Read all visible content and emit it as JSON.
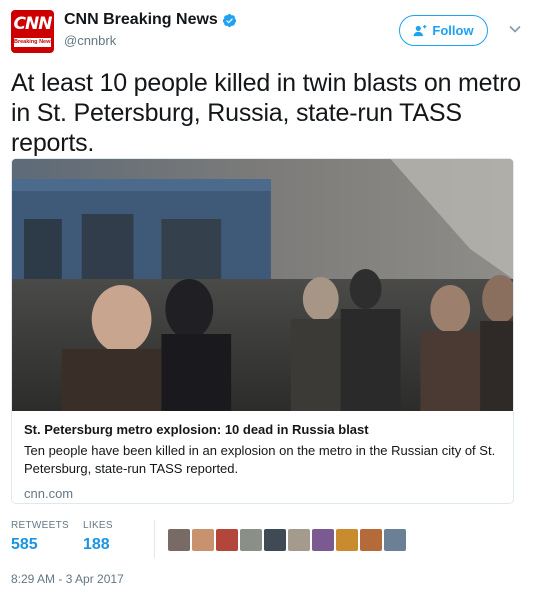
{
  "author": {
    "display_name": "CNN Breaking News",
    "handle": "@cnnbrk",
    "avatar_logo_text": "CNN",
    "avatar_strip_text": "Breaking News",
    "verified_icon": "verified-badge-icon",
    "verified_color": "#1da1f2"
  },
  "follow": {
    "label": "Follow",
    "icon": "follow-person-plus-icon",
    "color": "#1da1f2"
  },
  "more_icon": "chevron-down-icon",
  "tweet": {
    "text": "At least 10 people killed in twin blasts on metro in St. Petersburg, Russia, state-run TASS reports."
  },
  "card": {
    "title": "St. Petersburg metro explosion: 10 dead in Russia blast",
    "description": "Ten people have been killed in an explosion on the metro in the Russian city of St. Petersburg, state-run TASS reported.",
    "domain": "cnn.com"
  },
  "stats": {
    "retweets_label": "RETWEETS",
    "retweets_value": "585",
    "likes_label": "LIKES",
    "likes_value": "188"
  },
  "liker_avatar_colors": [
    "#7a6a66",
    "#c7926d",
    "#b3453a",
    "#8a8f88",
    "#3f4a55",
    "#a59a8e",
    "#7b5a92",
    "#c88b2e",
    "#b56a3a",
    "#6b7f95"
  ],
  "timestamp": "8:29 AM - 3 Apr 2017",
  "colors": {
    "link_blue": "#1b95e0",
    "muted": "#657786",
    "border": "#e1e8ed",
    "cnn_red": "#cc0000"
  }
}
